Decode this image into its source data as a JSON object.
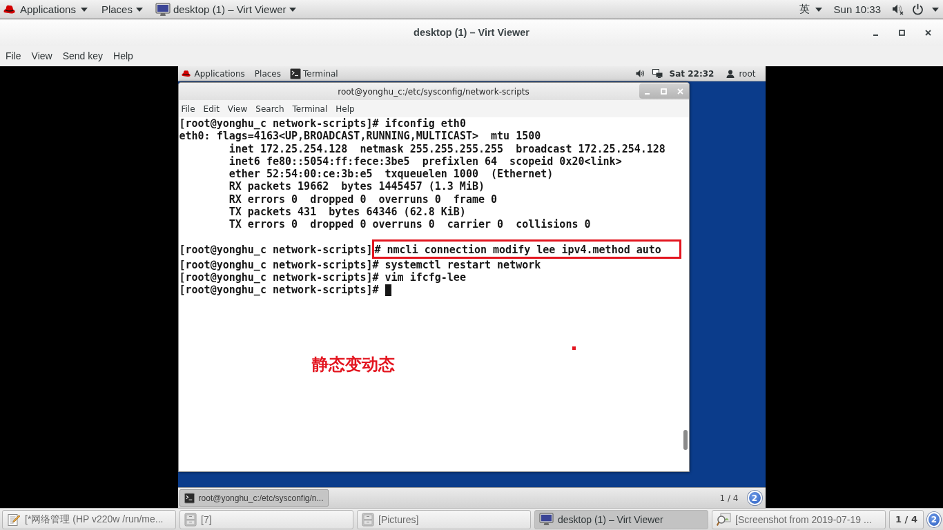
{
  "top_bar": {
    "menus": [
      {
        "kind": "apps",
        "label": "Applications"
      },
      {
        "kind": "plain",
        "label": "Places"
      },
      {
        "kind": "window",
        "label": "desktop (1) – Virt Viewer"
      }
    ],
    "input_method": "英",
    "clock": "Sun 10:33"
  },
  "window": {
    "title": "desktop (1) – Virt Viewer",
    "menu": [
      "File",
      "View",
      "Send key",
      "Help"
    ]
  },
  "guest": {
    "top_bar": {
      "menus": [
        {
          "kind": "apps",
          "label": "Applications"
        },
        {
          "kind": "plain",
          "label": "Places"
        },
        {
          "kind": "terminal",
          "label": "Terminal"
        }
      ],
      "clock": "Sat 22:32",
      "user": "root"
    },
    "terminal": {
      "title": "root@yonghu_c:/etc/sysconfig/network-scripts",
      "menu": [
        "File",
        "Edit",
        "View",
        "Search",
        "Terminal",
        "Help"
      ],
      "lines": [
        {
          "kind": "prompt",
          "prompt": "[root@yonghu_c network-scripts]",
          "text": "# ifconfig eth0",
          "highlighted": false,
          "cursor": false
        },
        {
          "kind": "output",
          "text": "eth0: flags=4163<UP,BROADCAST,RUNNING,MULTICAST>  mtu 1500",
          "highlighted": false,
          "cursor": false
        },
        {
          "kind": "detail",
          "text": "inet 172.25.254.128  netmask 255.255.255.255  broadcast 172.25.254.128",
          "highlighted": false,
          "cursor": false
        },
        {
          "kind": "detail",
          "text": "inet6 fe80::5054:ff:fece:3be5  prefixlen 64  scopeid 0x20<link>",
          "highlighted": false,
          "cursor": false
        },
        {
          "kind": "detail",
          "text": "ether 52:54:00:ce:3b:e5  txqueuelen 1000  (Ethernet)",
          "highlighted": false,
          "cursor": false
        },
        {
          "kind": "detail",
          "text": "RX packets 19662  bytes 1445457 (1.3 MiB)",
          "highlighted": false,
          "cursor": false
        },
        {
          "kind": "detail",
          "text": "RX errors 0  dropped 0  overruns 0  frame 0",
          "highlighted": false,
          "cursor": false
        },
        {
          "kind": "detail",
          "text": "TX packets 431  bytes 64346 (62.8 KiB)",
          "highlighted": false,
          "cursor": false
        },
        {
          "kind": "detail",
          "text": "TX errors 0  dropped 0 overruns 0  carrier 0  collisions 0",
          "highlighted": false,
          "cursor": false
        },
        {
          "kind": "blank",
          "highlighted": false,
          "cursor": false
        },
        {
          "kind": "prompt",
          "prompt": "[root@yonghu_c network-scripts]",
          "text": "# nmcli connection modify lee ipv4.method auto",
          "highlighted": true,
          "cursor": false
        },
        {
          "kind": "prompt",
          "prompt": "[root@yonghu_c network-scripts]",
          "text": "# systemctl restart network",
          "highlighted": false,
          "cursor": false
        },
        {
          "kind": "prompt",
          "prompt": "[root@yonghu_c network-scripts]",
          "text": "# vim ifcfg-lee",
          "highlighted": false,
          "cursor": false
        },
        {
          "kind": "prompt",
          "prompt": "[root@yonghu_c network-scripts]",
          "text": "#",
          "highlighted": false,
          "cursor": true
        }
      ]
    },
    "taskbar": {
      "items": [
        {
          "label": "root@yonghu_c:/etc/sysconfig/n...",
          "selected": true
        }
      ],
      "workspace": "1 / 4",
      "notifications": "2"
    }
  },
  "annotations": {
    "note": "静态变动态"
  },
  "taskbar": {
    "items": [
      {
        "kind": "editor",
        "label": "[*网络管理 (HP v220w /run/me...",
        "selected": false
      },
      {
        "kind": "folder",
        "label": "[7]",
        "selected": false
      },
      {
        "kind": "folder",
        "label": "[Pictures]",
        "selected": false
      },
      {
        "kind": "viewer",
        "label": "desktop (1) – Virt Viewer",
        "selected": true
      },
      {
        "kind": "screenshot",
        "label": "[Screenshot from 2019-07-19 ...",
        "selected": false
      }
    ],
    "workspace": "1 / 4",
    "notifications": "2"
  }
}
